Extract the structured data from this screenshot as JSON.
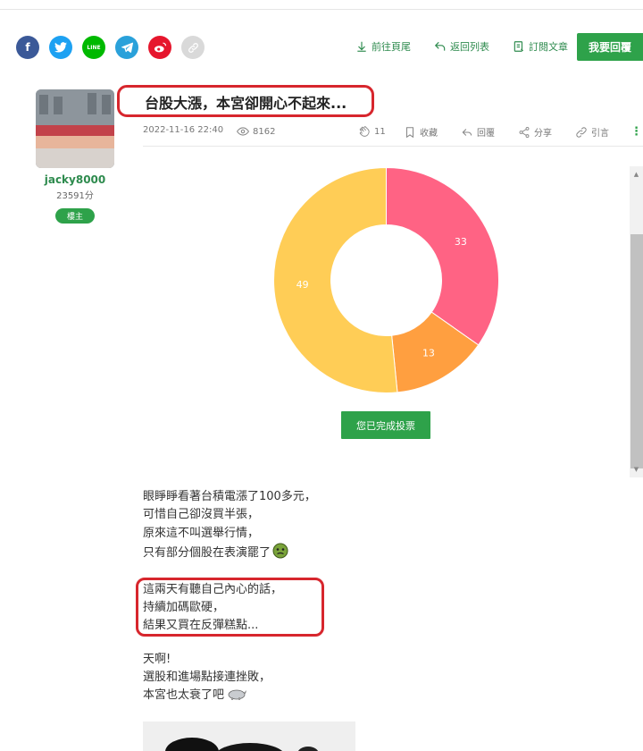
{
  "share_icons": [
    "facebook-icon",
    "twitter-icon",
    "line-icon",
    "telegram-icon",
    "weibo-icon",
    "link-icon"
  ],
  "share_text": {
    "facebook": "f",
    "line": "LINE"
  },
  "actions": {
    "go_bottom": "前往頁尾",
    "back_list": "返回列表",
    "subscribe": "訂閱文章",
    "reply_button": "我要回覆"
  },
  "user": {
    "name": "jacky8000",
    "points": "23591分",
    "badge": "樓主"
  },
  "post": {
    "title": "台股大漲，本宮卻開心不起來...",
    "date": "2022-11-16 22:40",
    "views": "8162",
    "likes": "11",
    "bookmark": "收藏",
    "reply": "回覆",
    "share": "分享",
    "quote": "引言"
  },
  "chart_data": {
    "type": "pie",
    "donut": true,
    "slices": [
      {
        "value": 33,
        "color": "#ff6384"
      },
      {
        "value": 13,
        "color": "#ff9f40"
      },
      {
        "value": 49,
        "color": "#ffcd56"
      }
    ]
  },
  "vote_button": "您已完成投票",
  "body": {
    "para1": [
      "眼睜睜看著台積電漲了100多元，",
      "可惜自己卻沒買半張，",
      "原來這不叫選舉行情，",
      "只有部分個股在表演罷了"
    ],
    "para2": [
      "這兩天有聽自己內心的話，",
      "持續加碼歐硬，",
      "結果又買在反彈糕點..."
    ],
    "para3": [
      "天啊!",
      "選股和進場點接連挫敗，",
      "本宮也太衰了吧"
    ]
  },
  "colors": {
    "accent_green": "#2ea24a",
    "highlight_red": "#d7262d"
  }
}
